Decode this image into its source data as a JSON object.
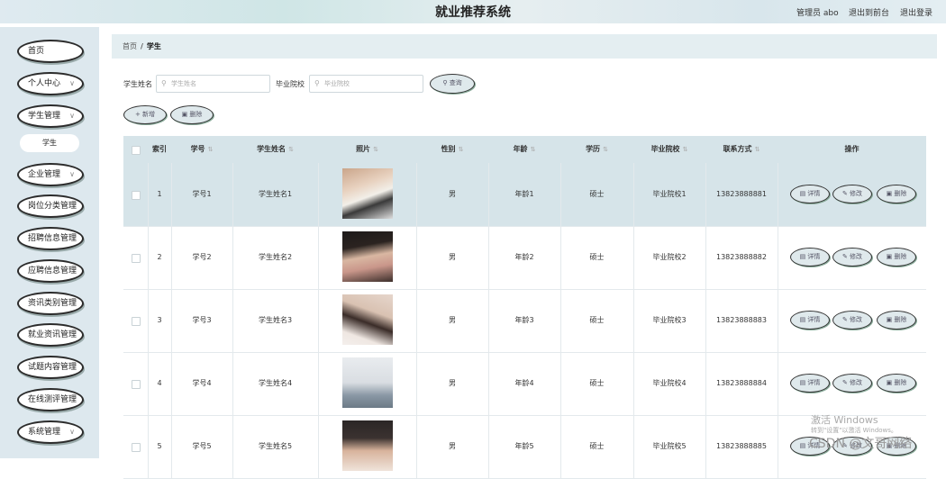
{
  "header": {
    "title": "就业推荐系统",
    "user": "管理员 abo",
    "to_front": "退出到前台",
    "logout": "退出登录"
  },
  "sidebar": {
    "items": [
      {
        "label": "首页",
        "chevron": false
      },
      {
        "label": "个人中心",
        "chevron": true
      },
      {
        "label": "学生管理",
        "chevron": true
      },
      {
        "label": "企业管理",
        "chevron": true
      },
      {
        "label": "岗位分类管理",
        "chevron": false
      },
      {
        "label": "招聘信息管理",
        "chevron": false
      },
      {
        "label": "应聘信息管理",
        "chevron": false
      },
      {
        "label": "资讯类别管理",
        "chevron": false
      },
      {
        "label": "就业资讯管理",
        "chevron": false
      },
      {
        "label": "试题内容管理",
        "chevron": false
      },
      {
        "label": "在线测评管理",
        "chevron": false
      },
      {
        "label": "系统管理",
        "chevron": true
      }
    ],
    "sub_item": "学生"
  },
  "breadcrumb": {
    "home": "首页",
    "separator": "/",
    "current": "学生"
  },
  "search": {
    "name_label": "学生姓名",
    "name_placeholder": "学生姓名",
    "school_label": "毕业院校",
    "school_placeholder": "毕业院校",
    "query_button": "查询"
  },
  "toolbar": {
    "add": "新增",
    "delete": "删除"
  },
  "table": {
    "columns": [
      "索引",
      "学号",
      "学生姓名",
      "照片",
      "性别",
      "年龄",
      "学历",
      "毕业院校",
      "联系方式",
      "操作"
    ],
    "sortable": [
      false,
      true,
      true,
      true,
      true,
      true,
      true,
      true,
      true,
      false
    ],
    "rows": [
      {
        "index": "1",
        "id": "学号1",
        "name": "学生姓名1",
        "gender": "男",
        "age": "年龄1",
        "edu": "硕士",
        "school": "毕业院校1",
        "phone": "13823888881"
      },
      {
        "index": "2",
        "id": "学号2",
        "name": "学生姓名2",
        "gender": "男",
        "age": "年龄2",
        "edu": "硕士",
        "school": "毕业院校2",
        "phone": "13823888882"
      },
      {
        "index": "3",
        "id": "学号3",
        "name": "学生姓名3",
        "gender": "男",
        "age": "年龄3",
        "edu": "硕士",
        "school": "毕业院校3",
        "phone": "13823888883"
      },
      {
        "index": "4",
        "id": "学号4",
        "name": "学生姓名4",
        "gender": "男",
        "age": "年龄4",
        "edu": "硕士",
        "school": "毕业院校4",
        "phone": "13823888884"
      },
      {
        "index": "5",
        "id": "学号5",
        "name": "学生姓名5",
        "gender": "男",
        "age": "年龄5",
        "edu": "硕士",
        "school": "毕业院校5",
        "phone": "13823888885"
      }
    ],
    "actions": {
      "detail": "详情",
      "edit": "修改",
      "delete": "删除"
    }
  },
  "watermark": {
    "activate": "激活 Windows",
    "activate_sub": "转到\"设置\"以激活 Windows。",
    "csdn": "CSDN @文哥网络"
  }
}
